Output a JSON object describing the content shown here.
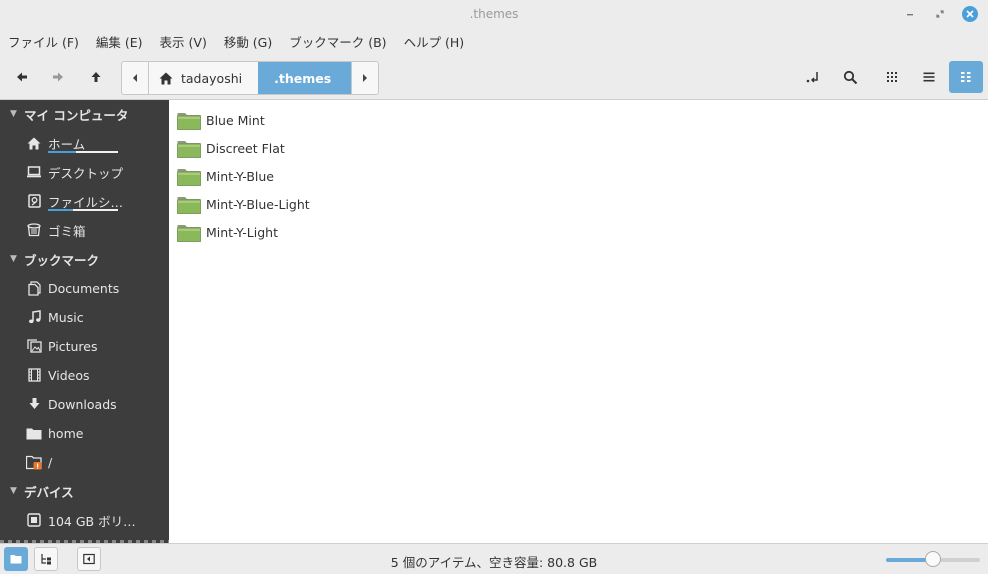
{
  "window": {
    "title": ".themes",
    "accent": "#6aaad8"
  },
  "menu": [
    "ファイル (F)",
    "編集 (E)",
    "表示 (V)",
    "移動 (G)",
    "ブックマーク (B)",
    "ヘルプ (H)"
  ],
  "path": {
    "crumbs": [
      "tadayoshi",
      ".themes"
    ]
  },
  "sidebar": {
    "sections": [
      {
        "title": "マイ コンピュータ",
        "items": [
          {
            "label": "ホーム",
            "icon": "home-icon",
            "usage": 0.4
          },
          {
            "label": "デスクトップ",
            "icon": "desktop-icon"
          },
          {
            "label": "ファイルシ…",
            "icon": "drive-icon",
            "usage": 0.35
          },
          {
            "label": "ゴミ箱",
            "icon": "trash-icon"
          }
        ]
      },
      {
        "title": "ブックマーク",
        "items": [
          {
            "label": "Documents",
            "icon": "documents-icon"
          },
          {
            "label": "Music",
            "icon": "music-icon"
          },
          {
            "label": "Pictures",
            "icon": "pictures-icon"
          },
          {
            "label": "Videos",
            "icon": "videos-icon"
          },
          {
            "label": "Downloads",
            "icon": "downloads-icon"
          },
          {
            "label": "home",
            "icon": "folder-icon"
          },
          {
            "label": "/",
            "icon": "folder-locked-icon"
          }
        ]
      },
      {
        "title": "デバイス",
        "items": [
          {
            "label": "104 GB ボリ…",
            "icon": "volume-icon"
          }
        ]
      }
    ]
  },
  "files": [
    "Blue Mint",
    "Discreet Flat",
    "Mint-Y-Blue",
    "Mint-Y-Blue-Light",
    "Mint-Y-Light"
  ],
  "status": {
    "text": "5 個のアイテム、空き容量: 80.8 GB",
    "zoom": 0.5
  }
}
